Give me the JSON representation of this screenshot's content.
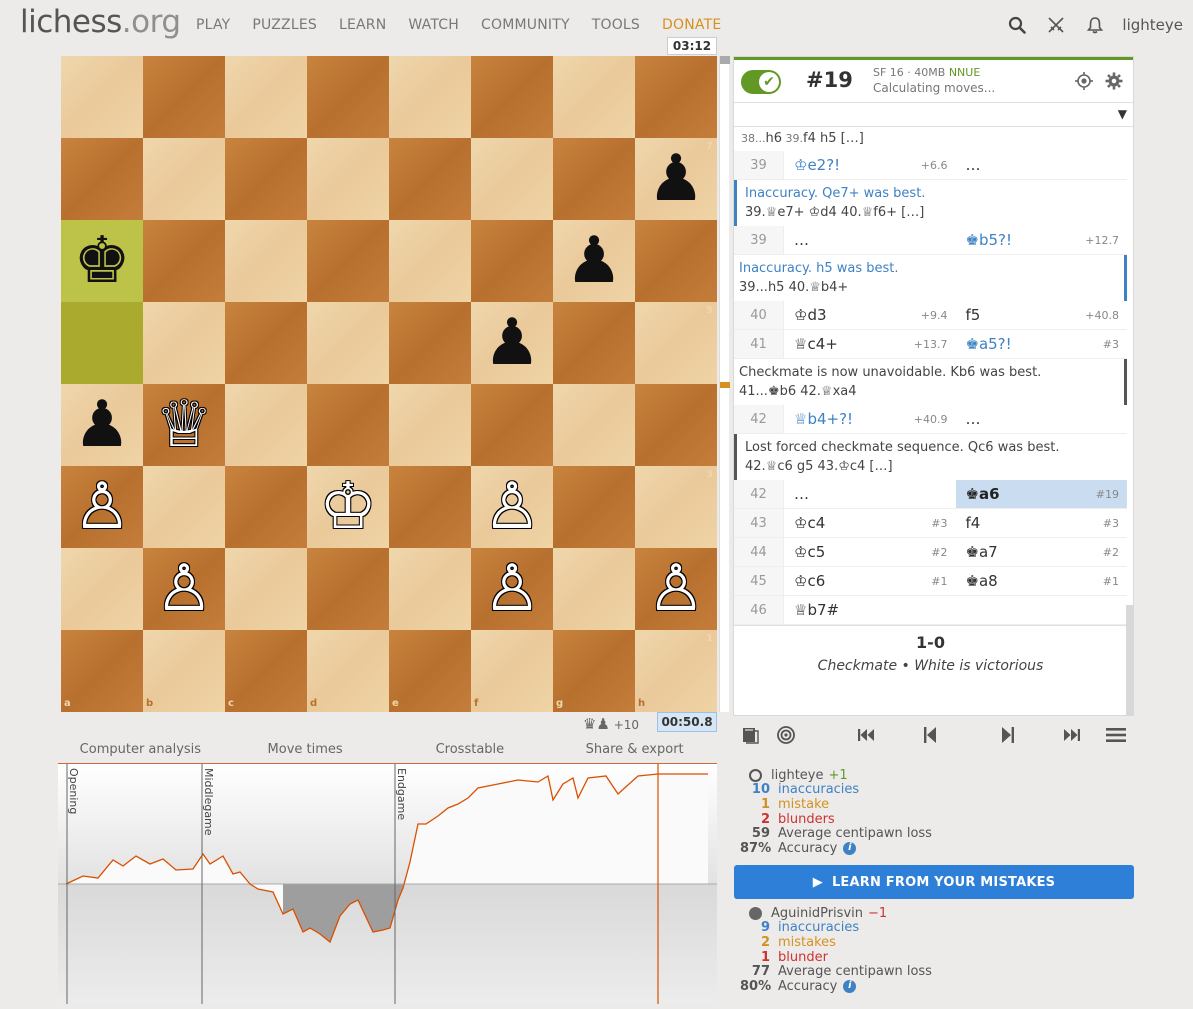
{
  "header": {
    "logo_main": "lichess",
    "logo_tld": ".org",
    "nav": [
      "PLAY",
      "PUZZLES",
      "LEARN",
      "WATCH",
      "COMMUNITY",
      "TOOLS",
      "DONATE"
    ],
    "username": "lighteye",
    "icons": [
      "search-icon",
      "swords-icon",
      "bell-icon"
    ]
  },
  "board": {
    "files": [
      "a",
      "b",
      "c",
      "d",
      "e",
      "f",
      "g",
      "h"
    ],
    "ranks": [
      "8",
      "7",
      "6",
      "5",
      "4",
      "3",
      "2",
      "1"
    ],
    "pieces": [
      {
        "sq": "h7",
        "glyph": "♟",
        "color": "black"
      },
      {
        "sq": "a6",
        "glyph": "♚",
        "color": "black"
      },
      {
        "sq": "g6",
        "glyph": "♟",
        "color": "black"
      },
      {
        "sq": "f5",
        "glyph": "♟",
        "color": "black"
      },
      {
        "sq": "a4",
        "glyph": "♟",
        "color": "black"
      },
      {
        "sq": "b4",
        "glyph": "♕",
        "color": "white"
      },
      {
        "sq": "a3",
        "glyph": "♙",
        "color": "white"
      },
      {
        "sq": "d3",
        "glyph": "♔",
        "color": "white"
      },
      {
        "sq": "f3",
        "glyph": "♙",
        "color": "white"
      },
      {
        "sq": "b2",
        "glyph": "♙",
        "color": "white"
      },
      {
        "sq": "f2",
        "glyph": "♙",
        "color": "white"
      },
      {
        "sq": "h2",
        "glyph": "♙",
        "color": "white"
      }
    ],
    "highlights": [
      {
        "sq": "a6",
        "tone": "hl"
      },
      {
        "sq": "a5",
        "tone": "hl2"
      }
    ],
    "clock_top": "03:12",
    "clock_bottom": "00:50.8",
    "material_diff": "+10"
  },
  "ceval": {
    "score": "#19",
    "engine": "SF 16 · 40MB",
    "nnue": "NNUE",
    "status": "Calculating moves...",
    "check": "✔"
  },
  "moves": {
    "top_line": {
      "parts": [
        "38...",
        "h6",
        " 39.",
        "f4",
        " h5",
        " […]"
      ]
    },
    "rows": [
      {
        "type": "row",
        "idx": "39",
        "w": "♔e2?!",
        "we": "+6.6",
        "wcls": "inacc",
        "b": "…",
        "be": "",
        "bcls": ""
      },
      {
        "type": "comment",
        "cls": "b-blue",
        "text": "Inaccuracy. Qe7+ was best.",
        "tcls": "blue",
        "line": "39.♕e7+ ♔d4 40.♕f6+ […]"
      },
      {
        "type": "row",
        "idx": "39",
        "w": "…",
        "we": "",
        "wcls": "",
        "b": "♚b5?!",
        "be": "+12.7",
        "bcls": "inacc"
      },
      {
        "type": "comment",
        "cls": "r-blue",
        "text": "Inaccuracy. h5 was best.",
        "tcls": "blue",
        "line": "39...h5 40.♕b4+"
      },
      {
        "type": "row",
        "idx": "40",
        "w": "♔d3",
        "we": "+9.4",
        "wcls": "",
        "b": "f5",
        "be": "+40.8",
        "bcls": ""
      },
      {
        "type": "row",
        "idx": "41",
        "w": "♕c4+",
        "we": "+13.7",
        "wcls": "",
        "b": "♚a5?!",
        "be": "#3",
        "bcls": "inacc"
      },
      {
        "type": "comment",
        "cls": "r-dark",
        "text": "Checkmate is now unavoidable. Kb6 was best.",
        "tcls": "dark",
        "line": "41...♚b6 42.♕xa4"
      },
      {
        "type": "row",
        "idx": "42",
        "w": "♕b4+?!",
        "we": "+40.9",
        "wcls": "inacc",
        "b": "…",
        "be": "",
        "bcls": ""
      },
      {
        "type": "comment",
        "cls": "b-dark",
        "text": "Lost forced checkmate sequence. Qc6 was best.",
        "tcls": "dark",
        "line": "42.♕c6 g5 43.♔c4 […]"
      },
      {
        "type": "row",
        "idx": "42",
        "w": "…",
        "we": "",
        "wcls": "",
        "b": "♚a6",
        "be": "#19",
        "bcls": "active"
      },
      {
        "type": "row",
        "idx": "43",
        "w": "♔c4",
        "we": "#3",
        "wcls": "",
        "b": "f4",
        "be": "#3",
        "bcls": ""
      },
      {
        "type": "row",
        "idx": "44",
        "w": "♔c5",
        "we": "#2",
        "wcls": "",
        "b": "♚a7",
        "be": "#2",
        "bcls": ""
      },
      {
        "type": "row",
        "idx": "45",
        "w": "♔c6",
        "we": "#1",
        "wcls": "",
        "b": "♚a8",
        "be": "#1",
        "bcls": ""
      },
      {
        "type": "row",
        "idx": "46",
        "w": "♕b7#",
        "we": "",
        "wcls": "",
        "b": "",
        "be": "",
        "bcls": ""
      }
    ],
    "result_score": "1-0",
    "result_status": "Checkmate • White is victorious"
  },
  "tabs": [
    "Computer analysis",
    "Move times",
    "Crosstable",
    "Share & export"
  ],
  "chart": {
    "phases": [
      "Opening",
      "Middlegame",
      "Endgame"
    ]
  },
  "white_stats": {
    "name": "lighteye",
    "rating_diff": "+1",
    "rows": [
      {
        "n": "10",
        "label": "inaccuracies",
        "cls": "c-inacc"
      },
      {
        "n": "1",
        "label": "mistake",
        "cls": "c-mist"
      },
      {
        "n": "2",
        "label": "blunders",
        "cls": "c-blun"
      },
      {
        "n": "59",
        "label": "Average centipawn loss",
        "cls": "c-acc"
      },
      {
        "n": "87%",
        "label": "Accuracy",
        "cls": "c-acc"
      }
    ]
  },
  "learn_button": "LEARN FROM YOUR MISTAKES",
  "black_stats": {
    "name": "AguinidPrisvin",
    "rating_diff": "−1",
    "rows": [
      {
        "n": "9",
        "label": "inaccuracies",
        "cls": "c-inacc"
      },
      {
        "n": "2",
        "label": "mistakes",
        "cls": "c-mist"
      },
      {
        "n": "1",
        "label": "blunder",
        "cls": "c-blun"
      },
      {
        "n": "77",
        "label": "Average centipawn loss",
        "cls": "c-acc"
      },
      {
        "n": "80%",
        "label": "Accuracy",
        "cls": "c-acc"
      }
    ]
  },
  "colors": {
    "accent": "#629924",
    "inaccuracy": "#3e82c4",
    "mistake": "#d59120",
    "blunder": "#cc3333",
    "button": "#2e7fd8"
  }
}
